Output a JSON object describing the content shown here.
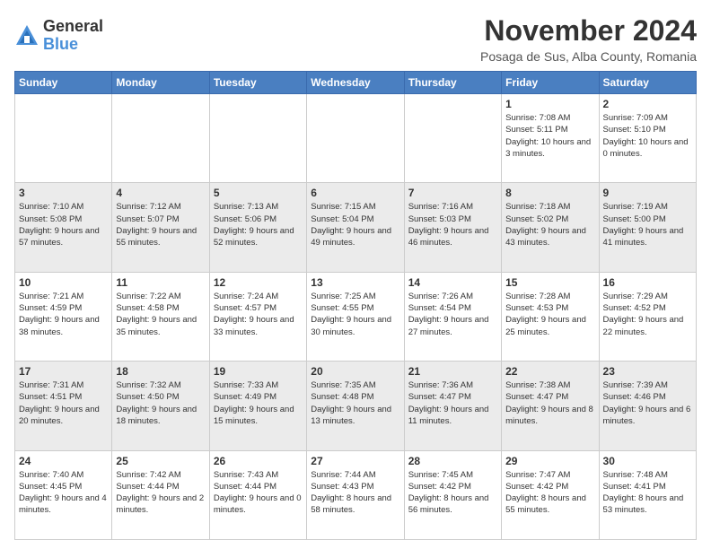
{
  "logo": {
    "general": "General",
    "blue": "Blue"
  },
  "title": "November 2024",
  "subtitle": "Posaga de Sus, Alba County, Romania",
  "days_header": [
    "Sunday",
    "Monday",
    "Tuesday",
    "Wednesday",
    "Thursday",
    "Friday",
    "Saturday"
  ],
  "weeks": [
    [
      {
        "day": "",
        "info": ""
      },
      {
        "day": "",
        "info": ""
      },
      {
        "day": "",
        "info": ""
      },
      {
        "day": "",
        "info": ""
      },
      {
        "day": "",
        "info": ""
      },
      {
        "day": "1",
        "info": "Sunrise: 7:08 AM\nSunset: 5:11 PM\nDaylight: 10 hours and 3 minutes."
      },
      {
        "day": "2",
        "info": "Sunrise: 7:09 AM\nSunset: 5:10 PM\nDaylight: 10 hours and 0 minutes."
      }
    ],
    [
      {
        "day": "3",
        "info": "Sunrise: 7:10 AM\nSunset: 5:08 PM\nDaylight: 9 hours and 57 minutes."
      },
      {
        "day": "4",
        "info": "Sunrise: 7:12 AM\nSunset: 5:07 PM\nDaylight: 9 hours and 55 minutes."
      },
      {
        "day": "5",
        "info": "Sunrise: 7:13 AM\nSunset: 5:06 PM\nDaylight: 9 hours and 52 minutes."
      },
      {
        "day": "6",
        "info": "Sunrise: 7:15 AM\nSunset: 5:04 PM\nDaylight: 9 hours and 49 minutes."
      },
      {
        "day": "7",
        "info": "Sunrise: 7:16 AM\nSunset: 5:03 PM\nDaylight: 9 hours and 46 minutes."
      },
      {
        "day": "8",
        "info": "Sunrise: 7:18 AM\nSunset: 5:02 PM\nDaylight: 9 hours and 43 minutes."
      },
      {
        "day": "9",
        "info": "Sunrise: 7:19 AM\nSunset: 5:00 PM\nDaylight: 9 hours and 41 minutes."
      }
    ],
    [
      {
        "day": "10",
        "info": "Sunrise: 7:21 AM\nSunset: 4:59 PM\nDaylight: 9 hours and 38 minutes."
      },
      {
        "day": "11",
        "info": "Sunrise: 7:22 AM\nSunset: 4:58 PM\nDaylight: 9 hours and 35 minutes."
      },
      {
        "day": "12",
        "info": "Sunrise: 7:24 AM\nSunset: 4:57 PM\nDaylight: 9 hours and 33 minutes."
      },
      {
        "day": "13",
        "info": "Sunrise: 7:25 AM\nSunset: 4:55 PM\nDaylight: 9 hours and 30 minutes."
      },
      {
        "day": "14",
        "info": "Sunrise: 7:26 AM\nSunset: 4:54 PM\nDaylight: 9 hours and 27 minutes."
      },
      {
        "day": "15",
        "info": "Sunrise: 7:28 AM\nSunset: 4:53 PM\nDaylight: 9 hours and 25 minutes."
      },
      {
        "day": "16",
        "info": "Sunrise: 7:29 AM\nSunset: 4:52 PM\nDaylight: 9 hours and 22 minutes."
      }
    ],
    [
      {
        "day": "17",
        "info": "Sunrise: 7:31 AM\nSunset: 4:51 PM\nDaylight: 9 hours and 20 minutes."
      },
      {
        "day": "18",
        "info": "Sunrise: 7:32 AM\nSunset: 4:50 PM\nDaylight: 9 hours and 18 minutes."
      },
      {
        "day": "19",
        "info": "Sunrise: 7:33 AM\nSunset: 4:49 PM\nDaylight: 9 hours and 15 minutes."
      },
      {
        "day": "20",
        "info": "Sunrise: 7:35 AM\nSunset: 4:48 PM\nDaylight: 9 hours and 13 minutes."
      },
      {
        "day": "21",
        "info": "Sunrise: 7:36 AM\nSunset: 4:47 PM\nDaylight: 9 hours and 11 minutes."
      },
      {
        "day": "22",
        "info": "Sunrise: 7:38 AM\nSunset: 4:47 PM\nDaylight: 9 hours and 8 minutes."
      },
      {
        "day": "23",
        "info": "Sunrise: 7:39 AM\nSunset: 4:46 PM\nDaylight: 9 hours and 6 minutes."
      }
    ],
    [
      {
        "day": "24",
        "info": "Sunrise: 7:40 AM\nSunset: 4:45 PM\nDaylight: 9 hours and 4 minutes."
      },
      {
        "day": "25",
        "info": "Sunrise: 7:42 AM\nSunset: 4:44 PM\nDaylight: 9 hours and 2 minutes."
      },
      {
        "day": "26",
        "info": "Sunrise: 7:43 AM\nSunset: 4:44 PM\nDaylight: 9 hours and 0 minutes."
      },
      {
        "day": "27",
        "info": "Sunrise: 7:44 AM\nSunset: 4:43 PM\nDaylight: 8 hours and 58 minutes."
      },
      {
        "day": "28",
        "info": "Sunrise: 7:45 AM\nSunset: 4:42 PM\nDaylight: 8 hours and 56 minutes."
      },
      {
        "day": "29",
        "info": "Sunrise: 7:47 AM\nSunset: 4:42 PM\nDaylight: 8 hours and 55 minutes."
      },
      {
        "day": "30",
        "info": "Sunrise: 7:48 AM\nSunset: 4:41 PM\nDaylight: 8 hours and 53 minutes."
      }
    ]
  ]
}
